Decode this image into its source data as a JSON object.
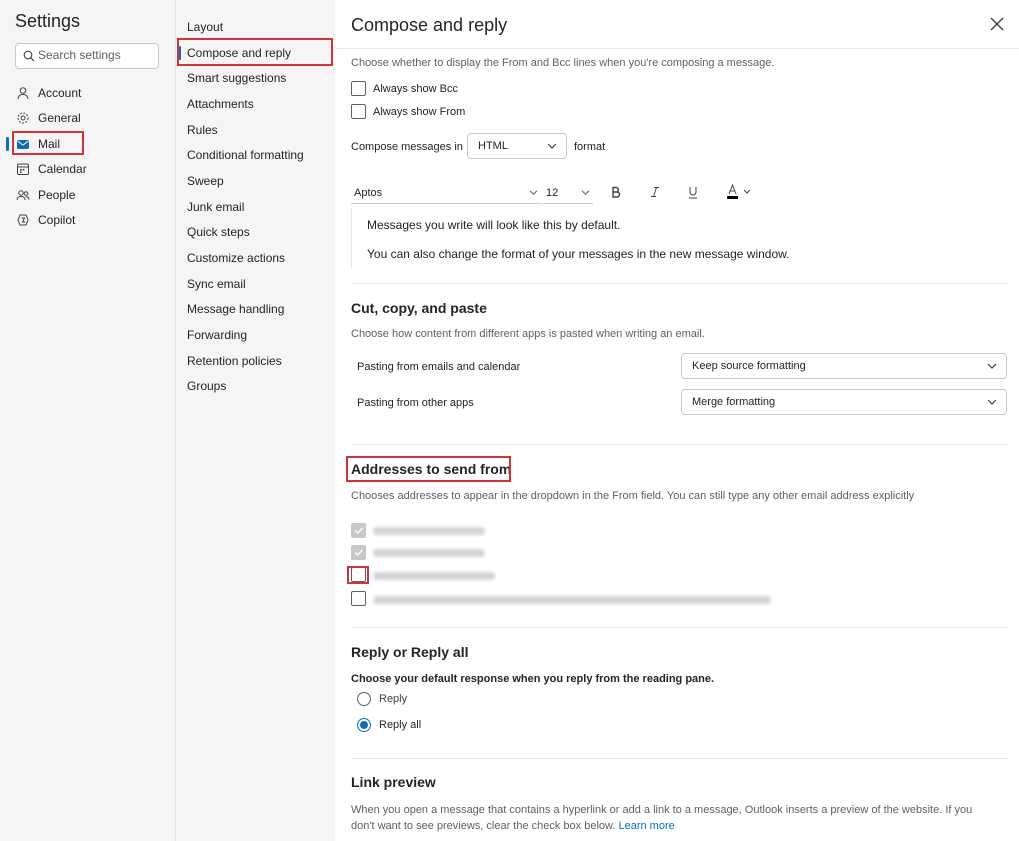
{
  "settings": {
    "title": "Settings",
    "search_placeholder": "Search settings",
    "nav": [
      {
        "label": "Account",
        "icon": "person-icon"
      },
      {
        "label": "General",
        "icon": "gear-icon"
      },
      {
        "label": "Mail",
        "icon": "mail-icon",
        "active": true
      },
      {
        "label": "Calendar",
        "icon": "calendar-icon"
      },
      {
        "label": "People",
        "icon": "people-icon"
      },
      {
        "label": "Copilot",
        "icon": "copilot-icon"
      }
    ]
  },
  "mail_nav": {
    "items": [
      "Layout",
      "Compose and reply",
      "Smart suggestions",
      "Attachments",
      "Rules",
      "Conditional formatting",
      "Sweep",
      "Junk email",
      "Quick steps",
      "Customize actions",
      "Sync email",
      "Message handling",
      "Forwarding",
      "Retention policies",
      "Groups"
    ],
    "active_index": 1
  },
  "main": {
    "title": "Compose and reply",
    "from_bcc_desc": "Choose whether to display the From and Bcc lines when you're composing a message.",
    "always_show_bcc": "Always show Bcc",
    "always_show_from": "Always show From",
    "compose_in_label": "Compose messages in",
    "compose_format": "HTML",
    "format_label": "format",
    "font_name": "Aptos",
    "font_size": "12",
    "preview_line1": "Messages you write will look like this by default.",
    "preview_line2": "You can also change the format of your messages in the new message window.",
    "cut_copy": {
      "heading": "Cut, copy, and paste",
      "desc": "Choose how content from different apps is pasted when writing an email.",
      "row1_label": "Pasting from emails and calendar",
      "row1_value": "Keep source formatting",
      "row2_label": "Pasting from other apps",
      "row2_value": "Merge formatting"
    },
    "addresses": {
      "heading": "Addresses to send from",
      "desc": "Chooses addresses to appear in the dropdown in the From field. You can still type any other email address explicitly"
    },
    "reply": {
      "heading": "Reply or Reply all",
      "desc": "Choose your default response when you reply from the reading pane.",
      "option1": "Reply",
      "option2": "Reply all",
      "selected": "Reply all"
    },
    "link_preview": {
      "heading": "Link preview",
      "desc": "When you open a message that contains a hyperlink or add a link to a message, Outlook inserts a preview of the website. If you don't want to see previews, clear the check box below.",
      "learn_more": "Learn more"
    }
  },
  "colors": {
    "accent": "#0f6cbd",
    "highlight": "#d13438"
  }
}
